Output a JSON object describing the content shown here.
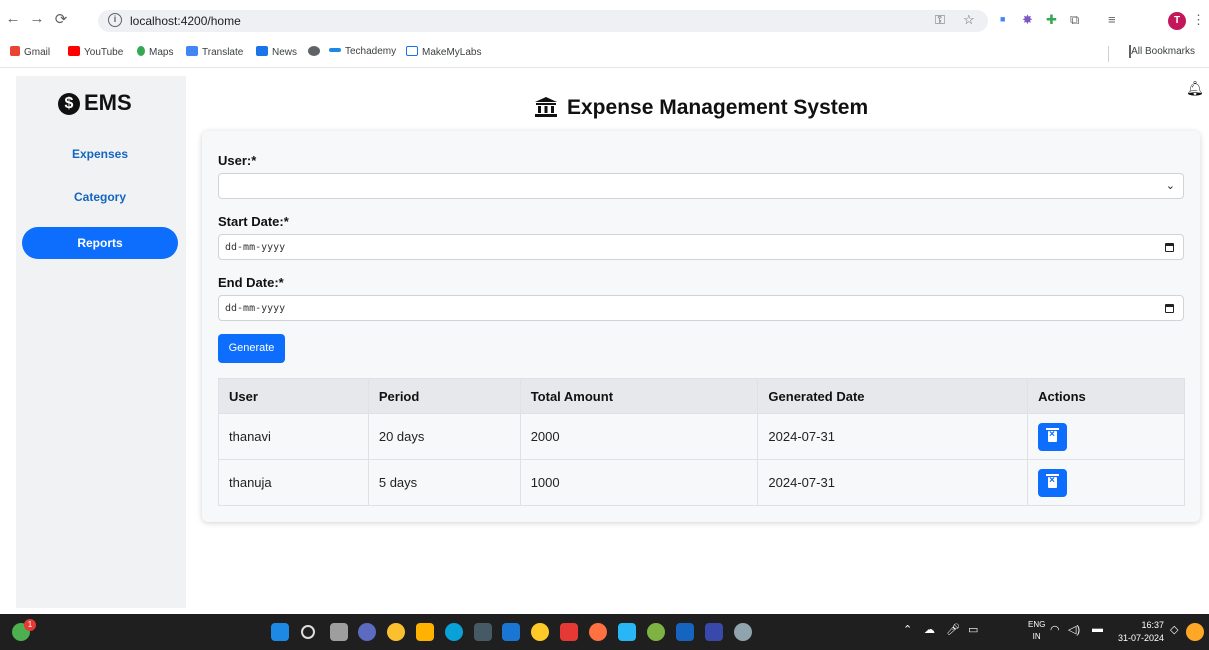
{
  "browser": {
    "url": "localhost:4200/home",
    "bookmarks": [
      "Gmail",
      "YouTube",
      "Maps",
      "Translate",
      "News",
      "",
      "Techademy",
      "MakeMyLabs"
    ],
    "all_bookmarks": "All Bookmarks",
    "profile_initial": "T"
  },
  "app": {
    "logo": "EMS",
    "title": "Expense Management System",
    "sidebar": [
      {
        "label": "Expenses",
        "active": false
      },
      {
        "label": "Category",
        "active": false
      },
      {
        "label": "Reports",
        "active": true
      }
    ]
  },
  "form": {
    "user_label": "User:*",
    "user_value": "",
    "start_label": "Start Date:*",
    "start_placeholder": "dd-mm-yyyy",
    "end_label": "End Date:*",
    "end_placeholder": "dd-mm-yyyy",
    "generate_label": "Generate"
  },
  "table": {
    "headers": [
      "User",
      "Period",
      "Total Amount",
      "Generated Date",
      "Actions"
    ],
    "rows": [
      {
        "user": "thanavi",
        "period": "20 days",
        "amount": "2000",
        "date": "2024-07-31"
      },
      {
        "user": "thanuja",
        "period": "5 days",
        "amount": "1000",
        "date": "2024-07-31"
      }
    ]
  },
  "taskbar": {
    "lang_top": "ENG",
    "lang_bottom": "IN",
    "time": "16:37",
    "date": "31-07-2024",
    "notification_count": "1"
  },
  "colors": {
    "accent": "#0d6efd",
    "sidebar_bg": "#f1f2f4"
  }
}
